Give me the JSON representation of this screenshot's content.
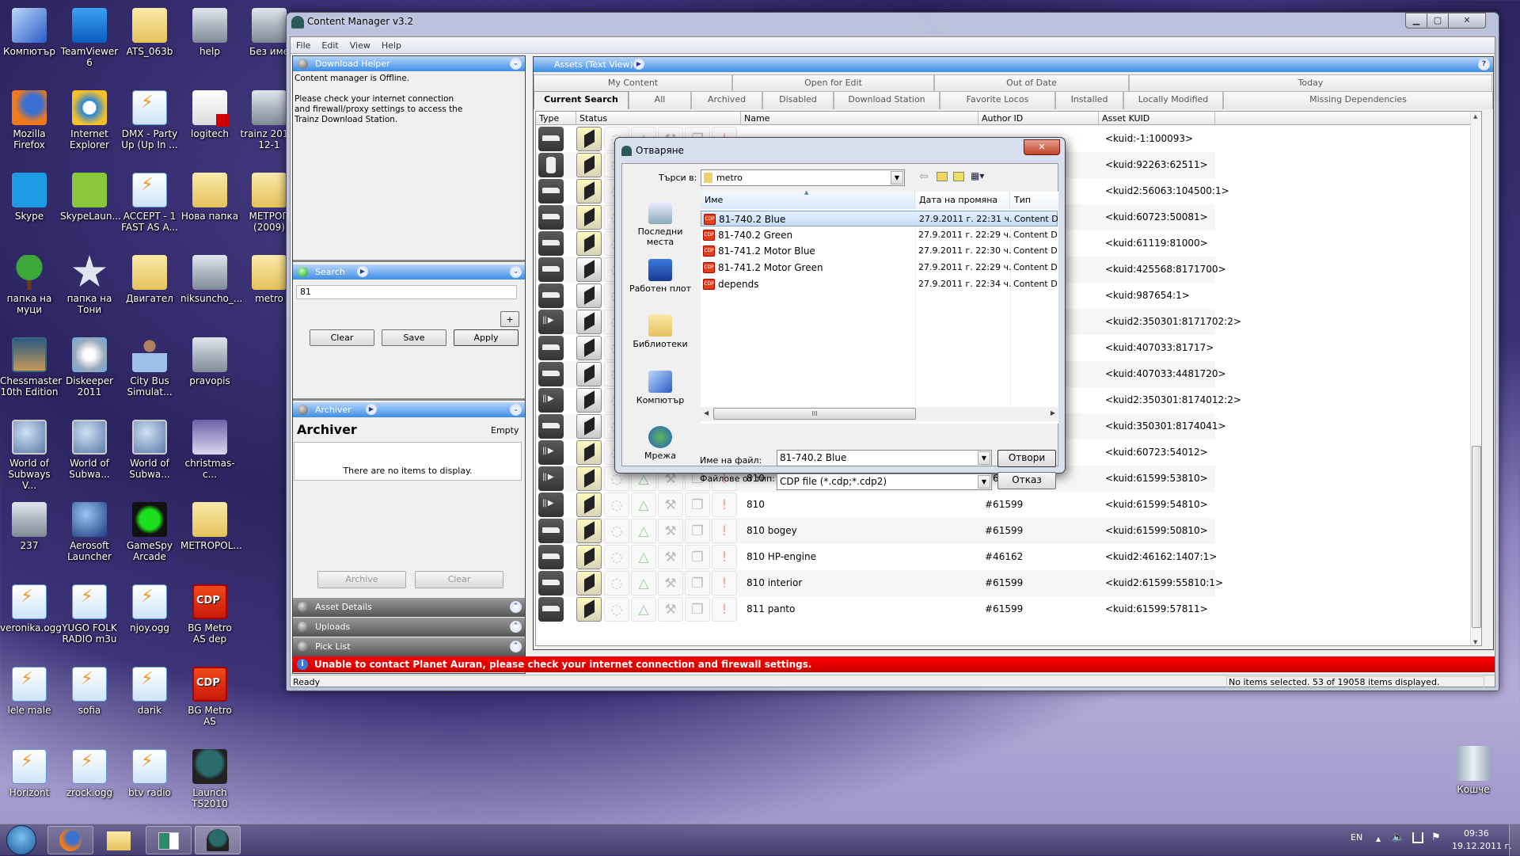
{
  "desktop": {
    "rows": [
      [
        {
          "label": "Компютър",
          "icon": "computer"
        },
        {
          "label": "TeamViewer 6",
          "icon": "teamviewer"
        },
        {
          "label": "ATS_063b",
          "icon": "folder"
        },
        {
          "label": "help",
          "icon": "image"
        },
        {
          "label": "Без име",
          "icon": "image"
        }
      ],
      [
        {
          "label": "Mozilla Firefox",
          "icon": "firefox"
        },
        {
          "label": "Internet Explorer",
          "icon": "ie"
        },
        {
          "label": "DMX - Party Up (Up In ...",
          "icon": "winamp"
        },
        {
          "label": "logitech",
          "icon": "pdf"
        },
        {
          "label": "trainz 2011-12-1",
          "icon": "image"
        }
      ],
      [
        {
          "label": "Skype",
          "icon": "skype"
        },
        {
          "label": "SkypeLaun...",
          "icon": "skypel"
        },
        {
          "label": "ACCEPT - 1 FAST AS A...",
          "icon": "winamp"
        },
        {
          "label": "Нова папка",
          "icon": "folder"
        },
        {
          "label": "МЕТРОП (2009)",
          "icon": "folder"
        }
      ],
      [
        {
          "label": "папка на муци",
          "icon": "tree"
        },
        {
          "label": "папка на Тони",
          "icon": "star"
        },
        {
          "label": "Двигател",
          "icon": "folder"
        },
        {
          "label": "niksuncho_...",
          "icon": "image"
        },
        {
          "label": "metro",
          "icon": "folder"
        }
      ],
      [
        {
          "label": "Chessmaster 10th Edition",
          "icon": "chess"
        },
        {
          "label": "Diskeeper 2011",
          "icon": "disk"
        },
        {
          "label": "City Bus Simulat...",
          "icon": "person"
        },
        {
          "label": "pravopis",
          "icon": "image"
        }
      ],
      [
        {
          "label": "World of Subways V...",
          "icon": "globe"
        },
        {
          "label": "World of Subwa...",
          "icon": "globe"
        },
        {
          "label": "World of Subwa...",
          "icon": "globe"
        },
        {
          "label": "christmas-c...",
          "icon": "photo"
        }
      ],
      [
        {
          "label": "237",
          "icon": "image"
        },
        {
          "label": "Aerosoft Launcher",
          "icon": "aerosoft"
        },
        {
          "label": "GameSpy Arcade",
          "icon": "gamespy"
        },
        {
          "label": "METROPOL...",
          "icon": "folder"
        }
      ],
      [
        {
          "label": "veronika.ogg",
          "icon": "winamp"
        },
        {
          "label": "YUGO FOLK RADIO m3u",
          "icon": "winamp"
        },
        {
          "label": "njoy.ogg",
          "icon": "winamp"
        },
        {
          "label": "BG Metro AS dep",
          "icon": "cdp"
        }
      ],
      [
        {
          "label": "lele male",
          "icon": "winamp"
        },
        {
          "label": "sofia",
          "icon": "winamp"
        },
        {
          "label": "darik",
          "icon": "winamp"
        },
        {
          "label": "BG Metro AS",
          "icon": "cdp"
        }
      ],
      [
        {
          "label": "Horizont",
          "icon": "winamp"
        },
        {
          "label": "zrock.ogg",
          "icon": "winamp"
        },
        {
          "label": "btv radio",
          "icon": "winamp"
        },
        {
          "label": "Launch TS2010",
          "icon": "loco"
        }
      ]
    ],
    "recycle_bin": "Кошче"
  },
  "window": {
    "title": "Content Manager v3.2",
    "menu": [
      "File",
      "Edit",
      "View",
      "Help"
    ],
    "download_helper": {
      "title": "Download Helper",
      "line1": "Content manager is Offline.",
      "line2": "Please check your internet connection and firewall/proxy settings to access the Trainz Download Station."
    },
    "search": {
      "title": "Search",
      "value": "81",
      "add": "+",
      "clear": "Clear",
      "save": "Save",
      "apply": "Apply"
    },
    "archiver": {
      "header": "Archiver",
      "title": "Archiver",
      "state": "Empty",
      "empty_text": "There are no items to display.",
      "archive": "Archive",
      "clear": "Clear"
    },
    "collapsed_panels": [
      "Asset Details",
      "Uploads",
      "Pick List"
    ],
    "assets": {
      "title": "Assets (Text View)",
      "help": "?",
      "tabs_row1": [
        "My Content",
        "Open for Edit",
        "Out of Date",
        "Today"
      ],
      "tabs_row2": [
        "Current Search",
        "All",
        "Archived",
        "Disabled",
        "Download Station",
        "Favorite Locos",
        "Installed",
        "Locally Modified",
        "Missing Dependencies"
      ],
      "selected_tab": "Current Search",
      "columns": [
        "Type",
        "Status",
        "Name",
        "Author ID",
        "Asset KUID"
      ],
      "rows": [
        {
          "type": "wagon",
          "highlight": true,
          "name": "",
          "author": "",
          "kuid": "<kuid:-1:100093>"
        },
        {
          "type": "barrel",
          "highlight": true,
          "name": "",
          "author": "",
          "kuid": "<kuid:92263:62511>"
        },
        {
          "type": "wagon",
          "highlight": true,
          "name": "",
          "author": "",
          "kuid": "<kuid2:56063:104500:1>"
        },
        {
          "type": "wagon",
          "highlight": true,
          "name": "",
          "author": "",
          "kuid": "<kuid:60723:50081>"
        },
        {
          "type": "wagon",
          "highlight": true,
          "name": "",
          "author": "",
          "kuid": "<kuid:61119:81000>"
        },
        {
          "type": "wagon",
          "highlight": false,
          "name": "",
          "author": "",
          "kuid": "<kuid:425568:8171700>"
        },
        {
          "type": "wagon",
          "highlight": false,
          "name": "",
          "author": "",
          "kuid": "<kuid:987654:1>"
        },
        {
          "type": "sound",
          "highlight": false,
          "name": "",
          "author": "",
          "kuid": "<kuid2:350301:8171702:2>"
        },
        {
          "type": "wagon",
          "highlight": false,
          "name": "",
          "author": "",
          "kuid": "<kuid:407033:81717>"
        },
        {
          "type": "wagon",
          "highlight": false,
          "name": "",
          "author": "",
          "kuid": "<kuid:407033:4481720>"
        },
        {
          "type": "sound",
          "highlight": false,
          "name": "",
          "author": "",
          "kuid": "<kuid2:350301:8174012:2>"
        },
        {
          "type": "wagon",
          "highlight": false,
          "name": "",
          "author": "",
          "kuid": "<kuid:350301:8174041>"
        },
        {
          "type": "sound",
          "highlight": true,
          "name": "",
          "author": "",
          "kuid": "<kuid:60723:54012>"
        },
        {
          "type": "sound",
          "highlight": true,
          "name": "810",
          "author": "#61599",
          "kuid": "<kuid:61599:53810>"
        },
        {
          "type": "sound",
          "highlight": true,
          "name": "810",
          "author": "#61599",
          "kuid": "<kuid:61599:54810>"
        },
        {
          "type": "wagon",
          "highlight": true,
          "name": "810 bogey",
          "author": "#61599",
          "kuid": "<kuid:61599:50810>"
        },
        {
          "type": "wagon",
          "highlight": true,
          "name": "810 HP-engine",
          "author": "#46162",
          "kuid": "<kuid2:46162:1407:1>"
        },
        {
          "type": "wagon",
          "highlight": true,
          "name": "810 interior",
          "author": "#61599",
          "kuid": "<kuid2:61599:55810:1>"
        },
        {
          "type": "wagon",
          "highlight": true,
          "name": "811 panto",
          "author": "#61599",
          "kuid": "<kuid:61599:57811>"
        }
      ]
    },
    "error_bar": "Unable to contact Planet Auran, please check your internet connection and firewall settings.",
    "status_left": "Ready",
    "status_right": "No items selected. 53 of 19058 items displayed."
  },
  "dialog": {
    "title": "Отваряне",
    "look_in_label": "Търси в:",
    "look_in_value": "metro",
    "places": [
      "Последни места",
      "Работен плот",
      "Библиотеки",
      "Компютър",
      "Мрежа"
    ],
    "columns": [
      "Име",
      "Дата на промяна",
      "Тип"
    ],
    "files": [
      {
        "name": "81-740.2 Blue",
        "date": "27.9.2011 г. 22:31 ч.",
        "type": "Content D",
        "selected": true
      },
      {
        "name": "81-740.2 Green",
        "date": "27.9.2011 г. 22:29 ч.",
        "type": "Content D",
        "selected": false
      },
      {
        "name": "81-741.2 Motor Blue",
        "date": "27.9.2011 г. 22:30 ч.",
        "type": "Content D",
        "selected": false
      },
      {
        "name": "81-741.2 Motor Green",
        "date": "27.9.2011 г. 22:29 ч.",
        "type": "Content D",
        "selected": false
      },
      {
        "name": "depends",
        "date": "27.9.2011 г. 22:34 ч.",
        "type": "Content D",
        "selected": false
      }
    ],
    "filename_label": "Име на файл:",
    "filename_value": "81-740.2 Blue",
    "filetype_label": "Файлове от тип:",
    "filetype_value": "CDP file (*.cdp;*.cdp2)",
    "open": "Отвори",
    "cancel": "Отказ",
    "scroll_grip": "III"
  },
  "taskbar": {
    "language": "EN",
    "time": "09:36",
    "date": "19.12.2011 г."
  }
}
